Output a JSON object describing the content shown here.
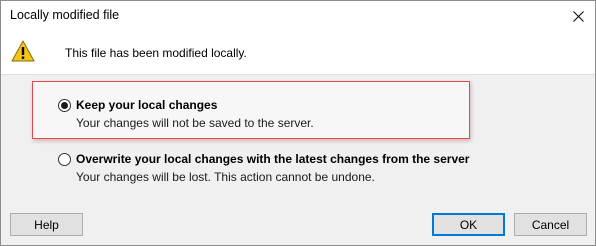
{
  "window": {
    "title": "Locally modified file",
    "close_icon": "close-icon"
  },
  "banner": {
    "icon": "warning-icon",
    "message": "This file has been modified locally."
  },
  "options": [
    {
      "label": "Keep your local changes",
      "description": "Your changes will not be saved to the server.",
      "selected": true
    },
    {
      "label": "Overwrite your local changes with the latest changes from the server",
      "description": "Your changes will be lost. This action cannot be undone.",
      "selected": false
    }
  ],
  "buttons": {
    "help": "Help",
    "ok": "OK",
    "cancel": "Cancel"
  },
  "colors": {
    "highlight_border": "#e04a4a",
    "warning_fill": "#f5c518",
    "default_button_border": "#0078d7"
  }
}
